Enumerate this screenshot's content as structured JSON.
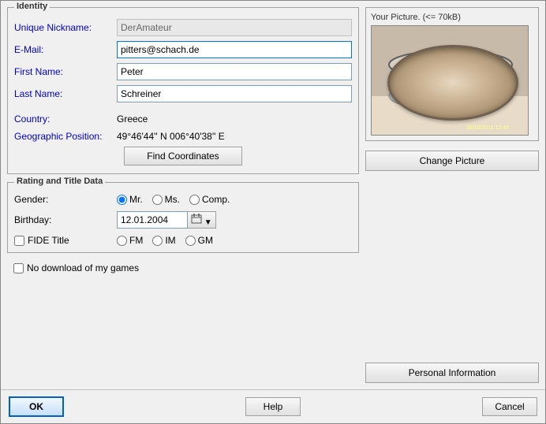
{
  "identity": {
    "group_title": "Identity",
    "nickname_label": "Unique Nickname:",
    "nickname_value": "DerAmateur",
    "email_label": "E-Mail:",
    "email_value": "pitters@schach.de",
    "firstname_label": "First Name:",
    "firstname_value": "Peter",
    "lastname_label": "Last Name:",
    "lastname_value": "Schreiner",
    "country_label": "Country:",
    "country_value": "Greece",
    "geo_label": "Geographic Position:",
    "geo_value": "49°46'44'' N  006°40'38'' E",
    "find_coords_btn": "Find Coordinates"
  },
  "picture": {
    "title": "Your Picture. (<= 70kB)",
    "timestamp": "09/10/2011 12:46",
    "change_btn": "Change Picture"
  },
  "personal_info_btn": "Personal Information",
  "rating": {
    "group_title": "Rating and Title Data",
    "gender_label": "Gender:",
    "gender_options": [
      "Mr.",
      "Ms.",
      "Comp."
    ],
    "gender_selected": "Mr.",
    "birthday_label": "Birthday:",
    "birthday_value": "12.01.2004",
    "fide_label": "FIDE Title",
    "fide_checked": false,
    "fide_options": [
      "FM",
      "IM",
      "GM"
    ],
    "fide_selected": null
  },
  "no_download": {
    "checked": false,
    "label": "No download of my games"
  },
  "footer": {
    "ok_label": "OK",
    "help_label": "Help",
    "cancel_label": "Cancel"
  }
}
